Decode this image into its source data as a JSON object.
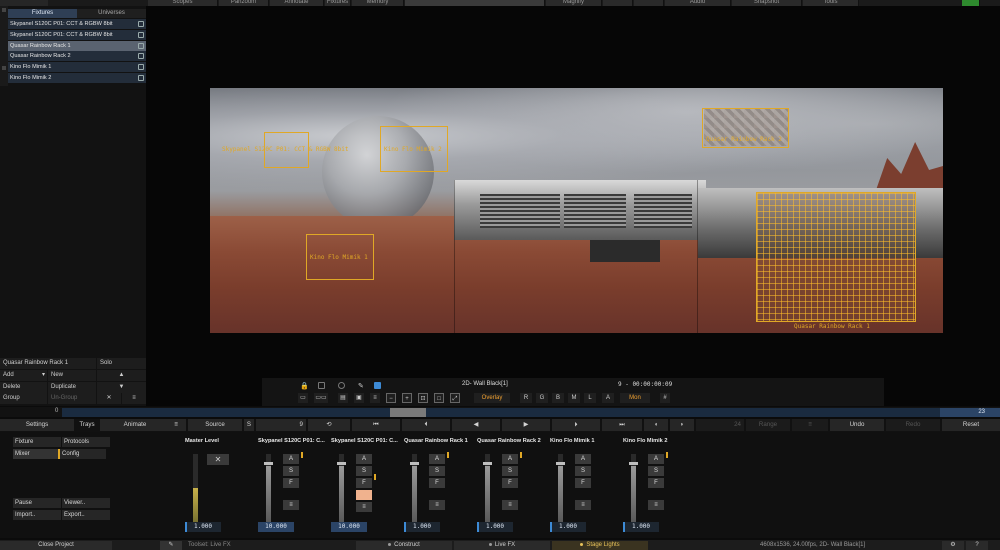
{
  "top_menu": [
    "Scopes",
    "Panzoom",
    "Annotate",
    "Fixtures",
    "Memory",
    "Magnify",
    "Audio",
    "Snapshot",
    "Tools"
  ],
  "left_panel": {
    "tabs": [
      "Fixtures",
      "Universes"
    ],
    "fixtures": [
      "Skypanel S120C P01: CCT & RGBW 8bit",
      "Skypanel S120C P01: CCT & RGBW 8bit",
      "Quasar Rainbow Rack 1",
      "Quasar Rainbow Rack 2",
      "Kino Flo Mimik 1",
      "Kino Flo Mimik 2"
    ],
    "selected_name": "Quasar Rainbow Rack 1",
    "solo": "Solo",
    "add": "Add",
    "new": "New",
    "delete": "Delete",
    "duplicate": "Duplicate",
    "group": "Group",
    "ungroup": "Un-Group"
  },
  "canvas": {
    "labels": {
      "skypanel": "Skypanel S120C P01: CCT & RGBW 8bit",
      "kino2": "Kino Flo Mimik 2",
      "kino1": "Kino Flo Mimik 1",
      "quasar2": "Quasar Rainbow Rack 2",
      "quasar1": "Quasar Rainbow Rack 1"
    }
  },
  "viewport_toolbar": {
    "title": "2D- Wall Black[1]",
    "timecode": "9  -  00:00:00:09",
    "overlay": "Overlay",
    "channels": [
      "R",
      "G",
      "B",
      "M",
      "L",
      "A"
    ],
    "mon": "Mon"
  },
  "timeline": {
    "start": "0",
    "end": "23"
  },
  "bottom_toolbar": {
    "settings": "Settings",
    "trays": "Trays",
    "animate": "Animate",
    "source": "Source",
    "s": "S",
    "frame": "9",
    "frame_end": "24",
    "range": "Range",
    "undo": "Undo",
    "redo": "Redo",
    "reset": "Reset"
  },
  "mixer": {
    "side": {
      "fixture": "Fixture",
      "protocols": "Protocols",
      "mixer": "Mixer",
      "config": "Config",
      "pause": "Pause",
      "viewer": "Viewer..",
      "import": "Import..",
      "export": "Export.."
    },
    "master": {
      "name": "Master Level",
      "value": "1.000",
      "x": "✕"
    },
    "button_labels": {
      "a": "A",
      "s": "S",
      "f": "F",
      "menu": "≡"
    },
    "channels": [
      {
        "name": "Skypanel S120C P01: C...",
        "value": "10.000"
      },
      {
        "name": "Skypanel S120C P01: C...",
        "value": "10.000"
      },
      {
        "name": "Quasar Rainbow Rack 1",
        "value": "1.000"
      },
      {
        "name": "Quasar Rainbow Rack 2",
        "value": "1.000"
      },
      {
        "name": "Kino Flo Mimik 1",
        "value": "1.000"
      },
      {
        "name": "Kino Flo Mimik 2",
        "value": "1.000"
      }
    ]
  },
  "footer": {
    "close_project": "Close Project",
    "toolset": "Toolset: Live FX",
    "construct": "Construct",
    "live_fx": "Live FX",
    "stage_lights": "Stage Lights",
    "info": "4608x1536, 24.00fps, 2D- Wall Black[1]",
    "help": "?"
  }
}
